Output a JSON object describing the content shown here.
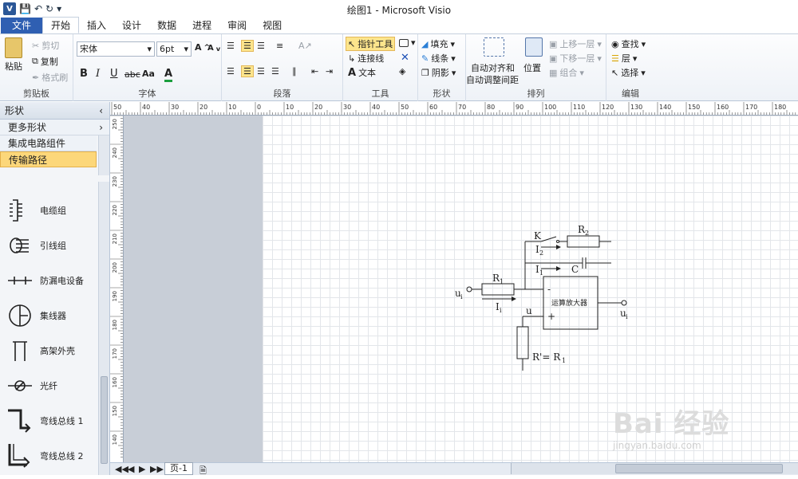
{
  "window": {
    "title": "绘图1 - Microsoft Visio"
  },
  "qat": {
    "app_icon": "V"
  },
  "tabs": [
    {
      "label": "文件"
    },
    {
      "label": "开始"
    },
    {
      "label": "插入"
    },
    {
      "label": "设计"
    },
    {
      "label": "数据"
    },
    {
      "label": "进程"
    },
    {
      "label": "审阅"
    },
    {
      "label": "视图"
    }
  ],
  "ribbon": {
    "clipboard": {
      "label": "剪贴板",
      "paste": "粘贴",
      "cut": "剪切",
      "copy": "复制",
      "format_painter": "格式刷"
    },
    "font": {
      "label": "字体",
      "font_name": "宋体",
      "font_size": "6pt",
      "bold": "B",
      "italic": "I",
      "underline": "U",
      "strike": "abc",
      "case": "Aa",
      "color": "A"
    },
    "paragraph": {
      "label": "段落"
    },
    "tools": {
      "label": "工具",
      "pointer": "指针工具",
      "connector": "连接线",
      "text": "文本"
    },
    "shape": {
      "label": "形状",
      "fill": "填充",
      "line": "线条",
      "shadow": "阴影"
    },
    "arrange": {
      "label": "排列",
      "auto_align": "自动对齐和",
      "auto_space": "自动调整间距",
      "position": "位置",
      "bring_forward": "上移一层",
      "send_backward": "下移一层",
      "group": "组合"
    },
    "edit": {
      "label": "编辑",
      "find": "查找",
      "layer": "层",
      "select": "选择"
    }
  },
  "shapes_panel": {
    "title": "形状",
    "more": "更多形状",
    "stencils": [
      {
        "label": "集成电路组件"
      },
      {
        "label": "传输路径"
      }
    ],
    "items": [
      {
        "label": "电缆组"
      },
      {
        "label": "引线组"
      },
      {
        "label": "防漏电设备"
      },
      {
        "label": "集线器"
      },
      {
        "label": "高架外壳"
      },
      {
        "label": "光纤"
      },
      {
        "label": "弯线总线 1"
      },
      {
        "label": "弯线总线 2"
      }
    ]
  },
  "ruler": {
    "h_ticks": [
      "50",
      "40",
      "30",
      "20",
      "10",
      "0",
      "10",
      "20",
      "30",
      "40",
      "50",
      "60",
      "70",
      "80",
      "90",
      "100",
      "110",
      "120",
      "130",
      "140",
      "150",
      "160",
      "170",
      "180"
    ],
    "v_ticks": [
      "250",
      "240",
      "230",
      "220",
      "210",
      "200",
      "190",
      "180",
      "170",
      "160",
      "150",
      "140"
    ]
  },
  "circuit": {
    "k": "K",
    "r2": "R",
    "r2_sub": "2",
    "i2": "I",
    "i2_sub": "2",
    "i1": "I",
    "i1_sub": "1",
    "c": "C",
    "r1": "R",
    "r1_sub": "1",
    "ui": "u",
    "ui_sub": "i",
    "ii": "I",
    "ii_sub": "i",
    "minus": "-",
    "plus": "+",
    "opamp": "运算放大器",
    "u": "u",
    "uo": "u",
    "uo_sub": "i",
    "rp": "R'= R",
    "rp_sub": "1"
  },
  "status": {
    "page_tab": "页-1"
  },
  "watermark": {
    "brand": "Bai 经验",
    "url": "jingyan.baidu.com"
  }
}
